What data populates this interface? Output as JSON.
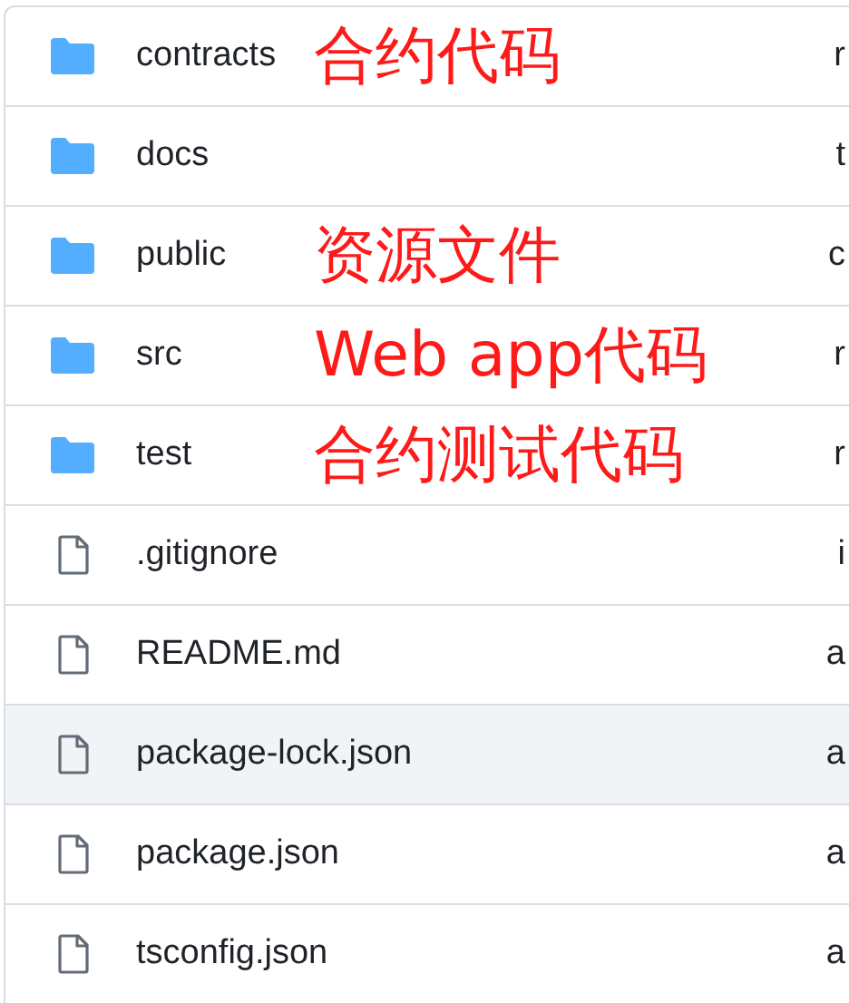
{
  "files": [
    {
      "name": "contracts",
      "kind": "folder",
      "annotation": "合约代码",
      "column_3": "r",
      "highlighted": false
    },
    {
      "name": "docs",
      "kind": "folder",
      "column_3": "t",
      "highlighted": false
    },
    {
      "name": "public",
      "kind": "folder",
      "annotation": "资源文件",
      "column_3": "c",
      "highlighted": false
    },
    {
      "name": "src",
      "kind": "folder",
      "annotation": "Web app代码",
      "column_3": "r",
      "highlighted": false
    },
    {
      "name": "test",
      "kind": "folder",
      "annotation": "合约测试代码",
      "column_3": "r",
      "highlighted": false
    },
    {
      "name": ".gitignore",
      "kind": "file",
      "column_3": "i",
      "highlighted": false
    },
    {
      "name": "README.md",
      "kind": "file",
      "column_3": "a",
      "highlighted": false
    },
    {
      "name": "package-lock.json",
      "kind": "file",
      "column_3": "a",
      "highlighted": true
    },
    {
      "name": "package.json",
      "kind": "file",
      "column_3": "a",
      "highlighted": false
    },
    {
      "name": "tsconfig.json",
      "kind": "file",
      "column_3": "a",
      "highlighted": false
    }
  ]
}
